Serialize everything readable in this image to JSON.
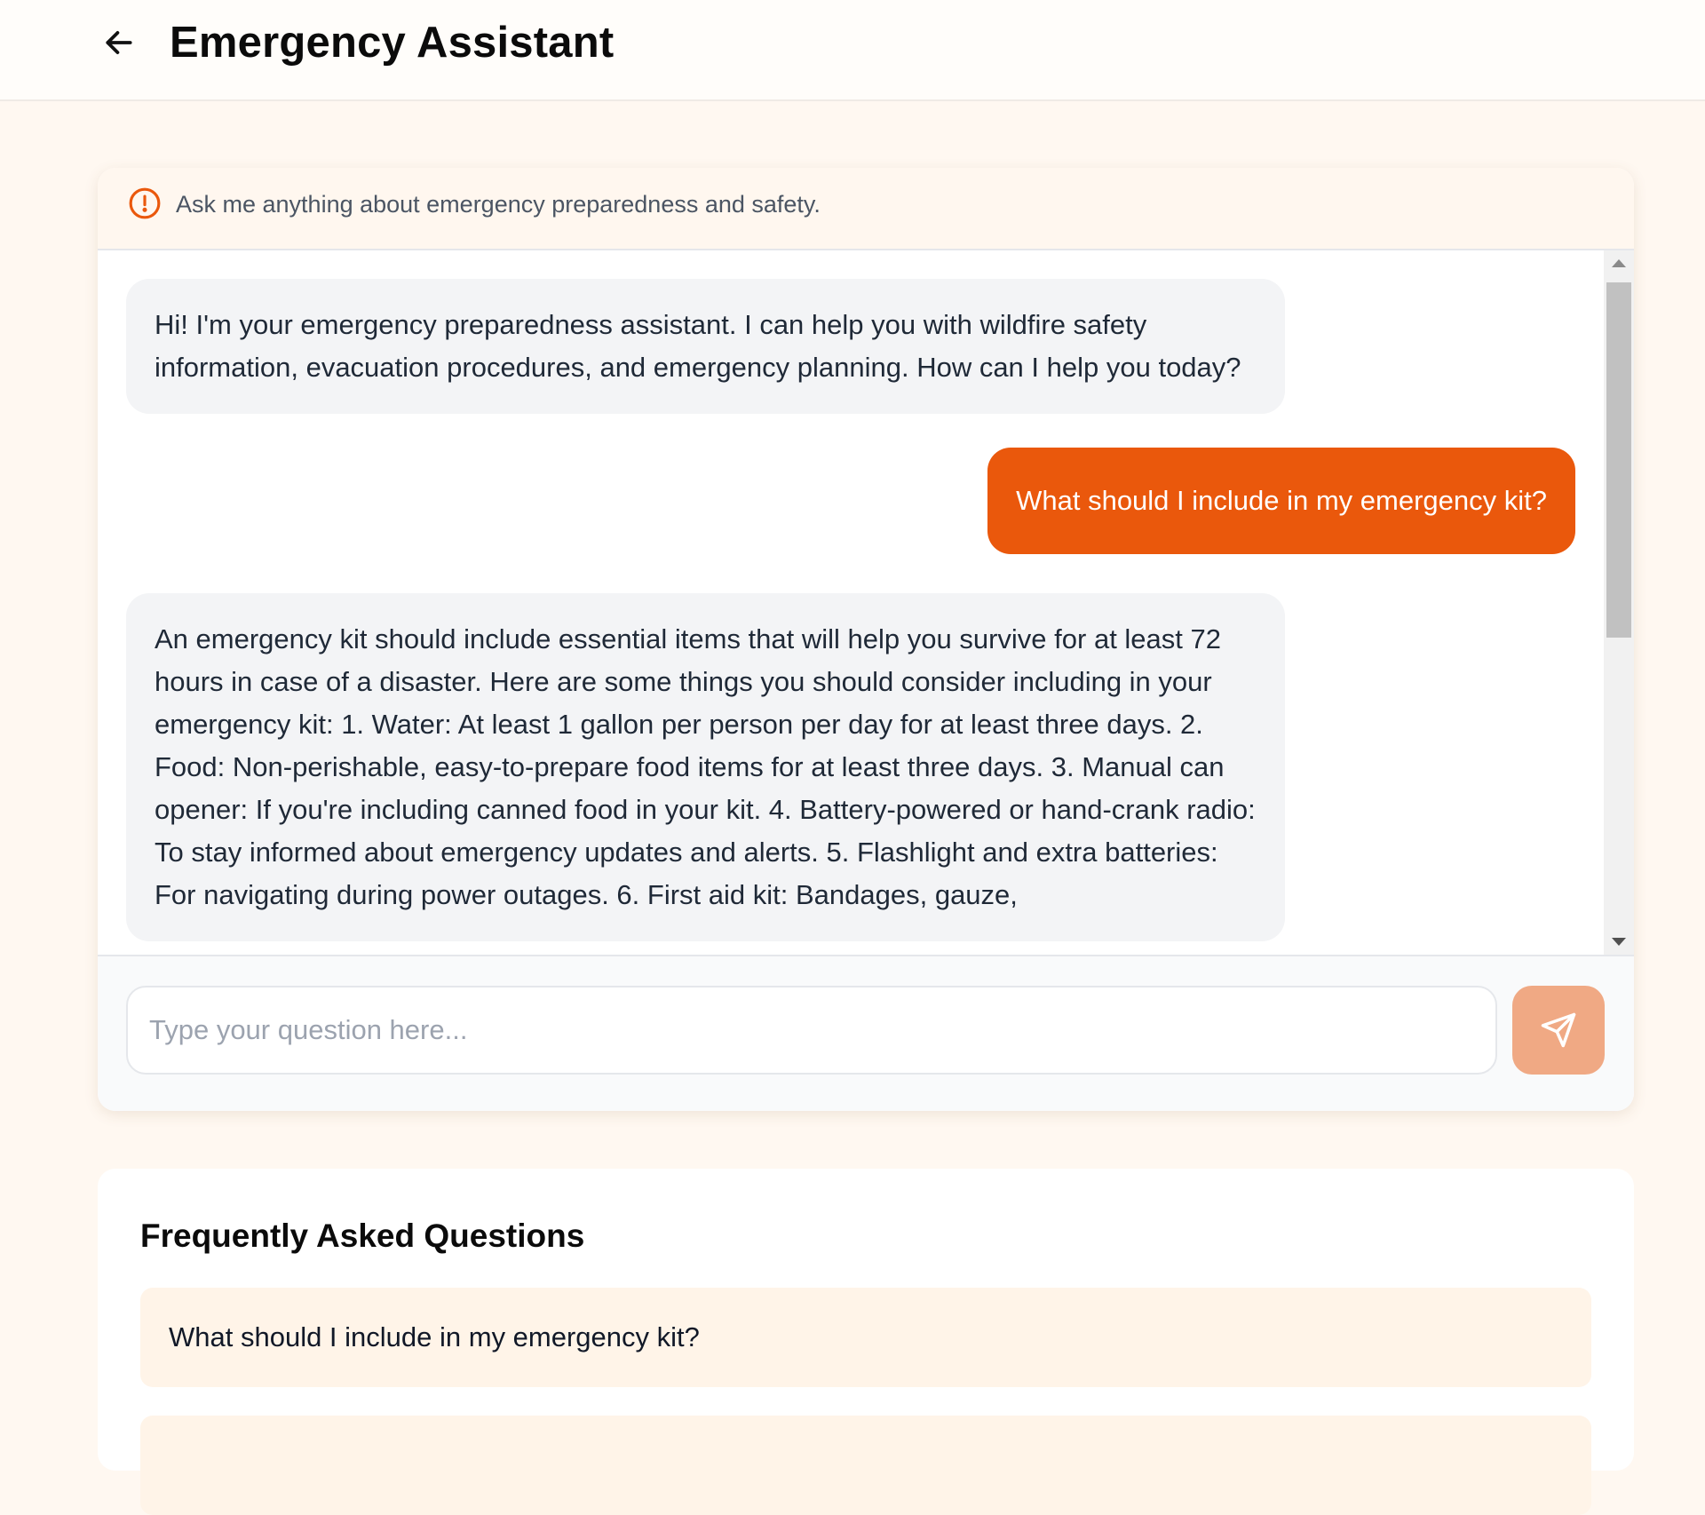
{
  "header": {
    "title": "Emergency Assistant",
    "back_icon": "arrow-left-icon"
  },
  "chat": {
    "info_icon": "alert-circle-icon",
    "info_text": "Ask me anything about emergency preparedness and safety.",
    "messages": [
      {
        "role": "assistant",
        "text": "Hi! I'm your emergency preparedness assistant. I can help you with wildfire safety information, evacuation procedures, and emergency planning. How can I help you today?"
      },
      {
        "role": "user",
        "text": "What should I include in my emergency kit?"
      },
      {
        "role": "assistant",
        "text": "An emergency kit should include essential items that will help you survive for at least 72 hours in case of a disaster. Here are some things you should consider including in your emergency kit: 1. Water: At least 1 gallon per person per day for at least three days. 2. Food: Non-perishable, easy-to-prepare food items for at least three days. 3. Manual can opener: If you're including canned food in your kit. 4. Battery-powered or hand-crank radio: To stay informed about emergency updates and alerts. 5. Flashlight and extra batteries: For navigating during power outages. 6. First aid kit: Bandages, gauze,"
      }
    ],
    "input_placeholder": "Type your question here...",
    "input_value": "",
    "send_icon": "send-icon"
  },
  "faq": {
    "title": "Frequently Asked Questions",
    "items": [
      "What should I include in my emergency kit?",
      ""
    ]
  },
  "colors": {
    "accent": "#ea580c",
    "accent_disabled": "#f0a984",
    "page_bg": "#fff8f1",
    "bot_bubble": "#f3f4f6",
    "faq_item_bg": "#fff4e8"
  }
}
